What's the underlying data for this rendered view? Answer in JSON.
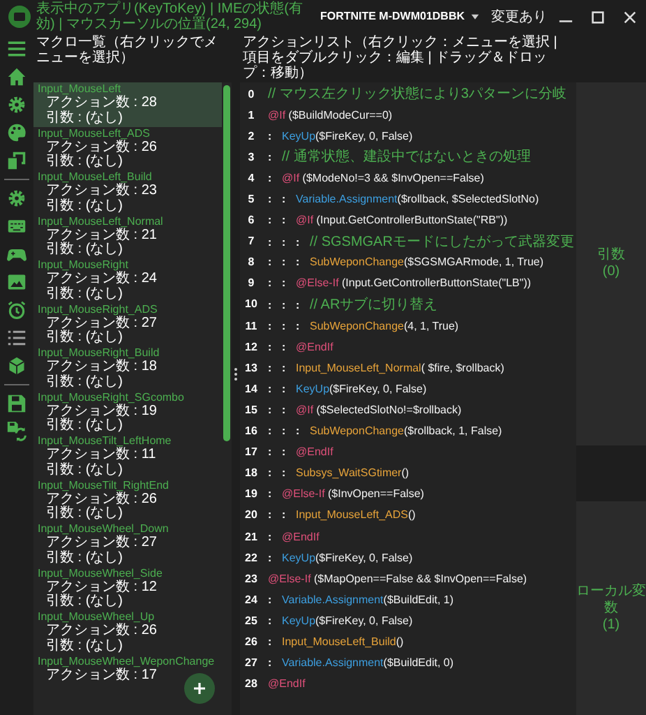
{
  "title_bar": {
    "status_text": "表示中のアプリ(KeyToKey) | IMEの状態(有効) | マウスカーソルの位置(24, 294)",
    "target_window": "FORTNITE M-DWM01DBBK",
    "change_status": "変更あり"
  },
  "macro_list": {
    "header": "マクロ一覧（右クリックでメニューを選択）",
    "items": [
      {
        "name": "Input_MouseLeft",
        "actions": "アクション数 : 28",
        "args": "引数 : (なし)",
        "selected": true
      },
      {
        "name": "Input_MouseLeft_ADS",
        "actions": "アクション数 : 26",
        "args": "引数 : (なし)",
        "selected": false
      },
      {
        "name": "Input_MouseLeft_Build",
        "actions": "アクション数 : 23",
        "args": "引数 : (なし)",
        "selected": false
      },
      {
        "name": "Input_MouseLeft_Normal",
        "actions": "アクション数 : 21",
        "args": "引数 : (なし)",
        "selected": false
      },
      {
        "name": "Input_MouseRight",
        "actions": "アクション数 : 24",
        "args": "引数 : (なし)",
        "selected": false
      },
      {
        "name": "Input_MouseRight_ADS",
        "actions": "アクション数 : 27",
        "args": "引数 : (なし)",
        "selected": false
      },
      {
        "name": "Input_MouseRight_Build",
        "actions": "アクション数 : 18",
        "args": "引数 : (なし)",
        "selected": false
      },
      {
        "name": "Input_MouseRight_SGcombo",
        "actions": "アクション数 : 19",
        "args": "引数 : (なし)",
        "selected": false
      },
      {
        "name": "Input_MouseTilt_LeftHome",
        "actions": "アクション数 : 11",
        "args": "引数 : (なし)",
        "selected": false
      },
      {
        "name": "Input_MouseTilt_RightEnd",
        "actions": "アクション数 : 26",
        "args": "引数 : (なし)",
        "selected": false
      },
      {
        "name": "Input_MouseWheel_Down",
        "actions": "アクション数 : 27",
        "args": "引数 : (なし)",
        "selected": false
      },
      {
        "name": "Input_MouseWheel_Side",
        "actions": "アクション数 : 12",
        "args": "引数 : (なし)",
        "selected": false
      },
      {
        "name": "Input_MouseWheel_Up",
        "actions": "アクション数 : 26",
        "args": "引数 : (なし)",
        "selected": false
      },
      {
        "name": "Input_MouseWheel_WeponChange",
        "actions": "アクション数 : 17",
        "selected": false
      }
    ]
  },
  "action_list": {
    "header": "アクションリスト（右クリック：メニューを選択 | 項目をダブルクリック：編集 | ドラッグ＆ドロップ：移動）",
    "lines": [
      {
        "number": "0",
        "tokens": [
          {
            "kind": "comment",
            "text": "// マウス左クリック状態により3パターンに分岐"
          }
        ]
      },
      {
        "number": "1",
        "tokens": [
          {
            "kind": "keyword",
            "text": "@If"
          },
          {
            "kind": "plain",
            "text": " ($BuildModeCur==0)"
          }
        ]
      },
      {
        "number": "2",
        "markers": [
          ":"
        ],
        "tokens": [
          {
            "kind": "builtin",
            "text": "KeyUp"
          },
          {
            "kind": "plain",
            "text": "($FireKey, 0, False)"
          }
        ]
      },
      {
        "number": "3",
        "markers": [
          ":"
        ],
        "tokens": [
          {
            "kind": "comment",
            "text": "// 通常状態、建設中ではないときの処理"
          }
        ]
      },
      {
        "number": "4",
        "markers": [
          ":"
        ],
        "tokens": [
          {
            "kind": "keyword",
            "text": "@If"
          },
          {
            "kind": "plain",
            "text": " ($ModeNo!=3 && $InvOpen==False)"
          }
        ]
      },
      {
        "number": "5",
        "markers": [
          ":",
          ":"
        ],
        "tokens": [
          {
            "kind": "builtin",
            "text": "Variable.Assignment"
          },
          {
            "kind": "plain",
            "text": "($rollback, $SelectedSlotNo)"
          }
        ]
      },
      {
        "number": "6",
        "markers": [
          ":",
          ":"
        ],
        "tokens": [
          {
            "kind": "keyword",
            "text": "@If"
          },
          {
            "kind": "plain",
            "text": " (Input.GetControllerButtonState(\"RB\"))"
          }
        ]
      },
      {
        "number": "7",
        "markers": [
          ":",
          ":",
          ":"
        ],
        "tokens": [
          {
            "kind": "comment",
            "text": "// SGSMGARモードにしたがって武器変更"
          }
        ]
      },
      {
        "number": "8",
        "markers": [
          ":",
          ":",
          ":"
        ],
        "tokens": [
          {
            "kind": "macro",
            "text": "SubWeponChange"
          },
          {
            "kind": "plain",
            "text": "($SGSMGARmode, 1, True)"
          }
        ]
      },
      {
        "number": "9",
        "markers": [
          ":",
          ":"
        ],
        "tokens": [
          {
            "kind": "keyword",
            "text": "@Else-If"
          },
          {
            "kind": "plain",
            "text": " (Input.GetControllerButtonState(\"LB\"))"
          }
        ]
      },
      {
        "number": "10",
        "markers": [
          ":",
          ":",
          ":"
        ],
        "tokens": [
          {
            "kind": "comment",
            "text": "// ARサブに切り替え"
          }
        ]
      },
      {
        "number": "11",
        "markers": [
          ":",
          ":",
          ":"
        ],
        "tokens": [
          {
            "kind": "macro",
            "text": "SubWeponChange"
          },
          {
            "kind": "plain",
            "text": "(4, 1, True)"
          }
        ]
      },
      {
        "number": "12",
        "markers": [
          ":",
          ":"
        ],
        "tokens": [
          {
            "kind": "keyword",
            "text": "@EndIf"
          }
        ]
      },
      {
        "number": "13",
        "markers": [
          ":",
          ":"
        ],
        "tokens": [
          {
            "kind": "macro",
            "text": "Input_MouseLeft_Normal"
          },
          {
            "kind": "plain",
            "text": "( $fire, $rollback)"
          }
        ]
      },
      {
        "number": "14",
        "markers": [
          ":",
          ":"
        ],
        "tokens": [
          {
            "kind": "builtin",
            "text": "KeyUp"
          },
          {
            "kind": "plain",
            "text": "($FireKey, 0, False)"
          }
        ]
      },
      {
        "number": "15",
        "markers": [
          ":",
          ":"
        ],
        "tokens": [
          {
            "kind": "keyword",
            "text": "@If"
          },
          {
            "kind": "plain",
            "text": " ($SelectedSlotNo!=$rollback)"
          }
        ]
      },
      {
        "number": "16",
        "markers": [
          ":",
          ":",
          ":"
        ],
        "tokens": [
          {
            "kind": "macro",
            "text": "SubWeponChange"
          },
          {
            "kind": "plain",
            "text": "($rollback, 1, False)"
          }
        ]
      },
      {
        "number": "17",
        "markers": [
          ":",
          ":"
        ],
        "tokens": [
          {
            "kind": "keyword",
            "text": "@EndIf"
          }
        ]
      },
      {
        "number": "18",
        "markers": [
          ":",
          ":"
        ],
        "tokens": [
          {
            "kind": "macro",
            "text": "Subsys_WaitSGtimer"
          },
          {
            "kind": "plain",
            "text": "()"
          }
        ]
      },
      {
        "number": "19",
        "markers": [
          ":"
        ],
        "tokens": [
          {
            "kind": "keyword",
            "text": "@Else-If"
          },
          {
            "kind": "plain",
            "text": " ($InvOpen==False)"
          }
        ]
      },
      {
        "number": "20",
        "markers": [
          ":",
          ":"
        ],
        "tokens": [
          {
            "kind": "macro",
            "text": "Input_MouseLeft_ADS"
          },
          {
            "kind": "plain",
            "text": "()"
          }
        ]
      },
      {
        "number": "21",
        "markers": [
          ":"
        ],
        "tokens": [
          {
            "kind": "keyword",
            "text": "@EndIf"
          }
        ]
      },
      {
        "number": "22",
        "markers": [
          ":"
        ],
        "tokens": [
          {
            "kind": "builtin",
            "text": "KeyUp"
          },
          {
            "kind": "plain",
            "text": "($FireKey, 0, False)"
          }
        ]
      },
      {
        "number": "23",
        "tokens": [
          {
            "kind": "keyword",
            "text": "@Else-If"
          },
          {
            "kind": "plain",
            "text": " ($MapOpen==False && $InvOpen==False)"
          }
        ]
      },
      {
        "number": "24",
        "markers": [
          ":"
        ],
        "tokens": [
          {
            "kind": "builtin",
            "text": "Variable.Assignment"
          },
          {
            "kind": "plain",
            "text": "($BuildEdit, 1)"
          }
        ]
      },
      {
        "number": "25",
        "markers": [
          ":"
        ],
        "tokens": [
          {
            "kind": "builtin",
            "text": "KeyUp"
          },
          {
            "kind": "plain",
            "text": "($FireKey, 0, False)"
          }
        ]
      },
      {
        "number": "26",
        "markers": [
          ":"
        ],
        "tokens": [
          {
            "kind": "macro",
            "text": "Input_MouseLeft_Build"
          },
          {
            "kind": "plain",
            "text": "()"
          }
        ]
      },
      {
        "number": "27",
        "markers": [
          ":"
        ],
        "tokens": [
          {
            "kind": "builtin",
            "text": "Variable.Assignment"
          },
          {
            "kind": "plain",
            "text": "($BuildEdit, 0)"
          }
        ]
      },
      {
        "number": "28",
        "tokens": [
          {
            "kind": "keyword",
            "text": "@EndIf"
          }
        ]
      }
    ]
  },
  "arguments_panel": {
    "label": "引数",
    "count": "(0)"
  },
  "local_variables_panel": {
    "label": "ローカル変数",
    "count": "(1)"
  }
}
